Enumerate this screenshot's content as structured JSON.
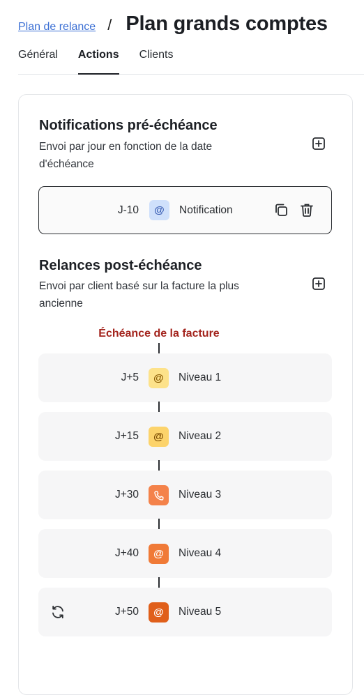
{
  "header": {
    "breadcrumb": "Plan de relance",
    "separator": "/",
    "title": "Plan grands comptes"
  },
  "tabs": [
    {
      "label": "Général",
      "active": false
    },
    {
      "label": "Actions",
      "active": true
    },
    {
      "label": "Clients",
      "active": false
    }
  ],
  "pre_section": {
    "title": "Notifications pré-échéance",
    "description": "Envoi par jour en fonction de la date d'échéance",
    "add_icon": "plus-square-icon",
    "rows": [
      {
        "day": "J-10",
        "channel_icon": "at-icon",
        "channel_color": "#cfe0fb",
        "label": "Notification",
        "actions": [
          "copy-icon",
          "trash-icon"
        ]
      }
    ]
  },
  "post_section": {
    "title": "Relances post-échéance",
    "description": "Envoi par client basé sur la facture la plus ancienne",
    "add_icon": "plus-square-icon",
    "due_label": "Échéance de la facture",
    "due_color": "#a3241d",
    "rows": [
      {
        "day": "J+5",
        "channel_icon": "at-icon",
        "channel_color": "#fde28a",
        "label": "Niveau 1"
      },
      {
        "day": "J+15",
        "channel_icon": "at-icon",
        "channel_color": "#fcd36b",
        "label": "Niveau 2"
      },
      {
        "day": "J+30",
        "channel_icon": "phone-icon",
        "channel_color": "#f4824a",
        "label": "Niveau 3"
      },
      {
        "day": "J+40",
        "channel_icon": "at-icon",
        "channel_color": "#f07a37",
        "label": "Niveau 4"
      },
      {
        "day": "J+50",
        "channel_icon": "at-icon",
        "channel_color": "#e05f1a",
        "label": "Niveau 5",
        "extra_icon": "refresh-icon"
      }
    ]
  }
}
